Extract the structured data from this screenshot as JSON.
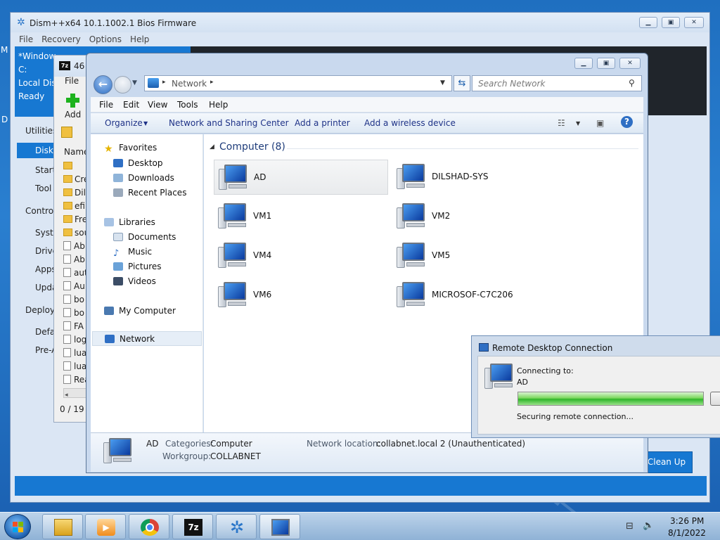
{
  "dism": {
    "title": "Dism++x64 10.1.1002.1 Bios Firmware",
    "menu": [
      "File",
      "Recovery",
      "Options",
      "Help"
    ],
    "session": {
      "name": "*Window",
      "drive": "C:",
      "disk": "Local Disk",
      "status": "Ready"
    },
    "nav": [
      {
        "label": "Utilities",
        "selected": false
      },
      {
        "label": "Disk",
        "selected": true
      },
      {
        "label": "Start",
        "selected": false
      },
      {
        "label": "Tool",
        "selected": false
      },
      {
        "label": "Control",
        "selected": false
      },
      {
        "label": "Syste",
        "selected": false
      },
      {
        "label": "Drive",
        "selected": false
      },
      {
        "label": "Apps",
        "selected": false
      },
      {
        "label": "Upda",
        "selected": false
      },
      {
        "label": "Deploy",
        "selected": false
      },
      {
        "label": "Defa",
        "selected": false
      },
      {
        "label": "Pre-A",
        "selected": false
      }
    ],
    "cleanup_label": "Clean Up"
  },
  "sevenzip": {
    "title": "46",
    "menu_file": "File",
    "add_label": "Add",
    "column_name": "Name",
    "rows": [
      "",
      "Cre",
      "Dil",
      "efi",
      "Fre",
      "sou",
      "Ab",
      "Ab",
      "aut",
      "Au",
      "bo",
      "bo",
      "FA",
      "log",
      "lua",
      "lua",
      "Rea"
    ],
    "row_types": [
      "folder",
      "folder",
      "folder",
      "folder",
      "folder",
      "folder",
      "doc",
      "doc",
      "doc",
      "doc",
      "doc",
      "doc",
      "doc",
      "doc",
      "doc",
      "doc",
      "doc"
    ],
    "status": "0 / 19 c"
  },
  "explorer": {
    "breadcrumb": "Network",
    "search_placeholder": "Search Network",
    "menu": [
      "File",
      "Edit",
      "View",
      "Tools",
      "Help"
    ],
    "commands": [
      "Organize",
      "Network and Sharing Center",
      "Add a printer",
      "Add a wireless device"
    ],
    "nav": {
      "favorites": "Favorites",
      "desktop": "Desktop",
      "downloads": "Downloads",
      "recent": "Recent Places",
      "libraries": "Libraries",
      "documents": "Documents",
      "music": "Music",
      "pictures": "Pictures",
      "videos": "Videos",
      "my_computer": "My Computer",
      "network": "Network"
    },
    "group_title": "Computer (8)",
    "computers": [
      "AD",
      "DILSHAD-SYS",
      "VM1",
      "VM2",
      "VM4",
      "VM5",
      "VM6",
      "MICROSOF-C7C206"
    ],
    "details": {
      "name": "AD",
      "categories_label": "Categories:",
      "categories": "Computer",
      "workgroup_label": "Workgroup:",
      "workgroup": "COLLABNET",
      "location_label": "Network location:",
      "location": "collabnet.local  2 (Unauthenticated)"
    }
  },
  "rdp": {
    "title": "Remote Desktop Connection",
    "connecting_label": "Connecting to:",
    "target": "AD",
    "status": "Securing remote connection...",
    "progress": 1.0
  },
  "taskbar": {
    "time": "3:26 PM",
    "date": "8/1/2022",
    "apps": [
      "explorer",
      "media-player",
      "chrome",
      "7-zip",
      "dism",
      "remote-desktop"
    ]
  },
  "desktop_edge_letters": [
    "M",
    "D"
  ]
}
